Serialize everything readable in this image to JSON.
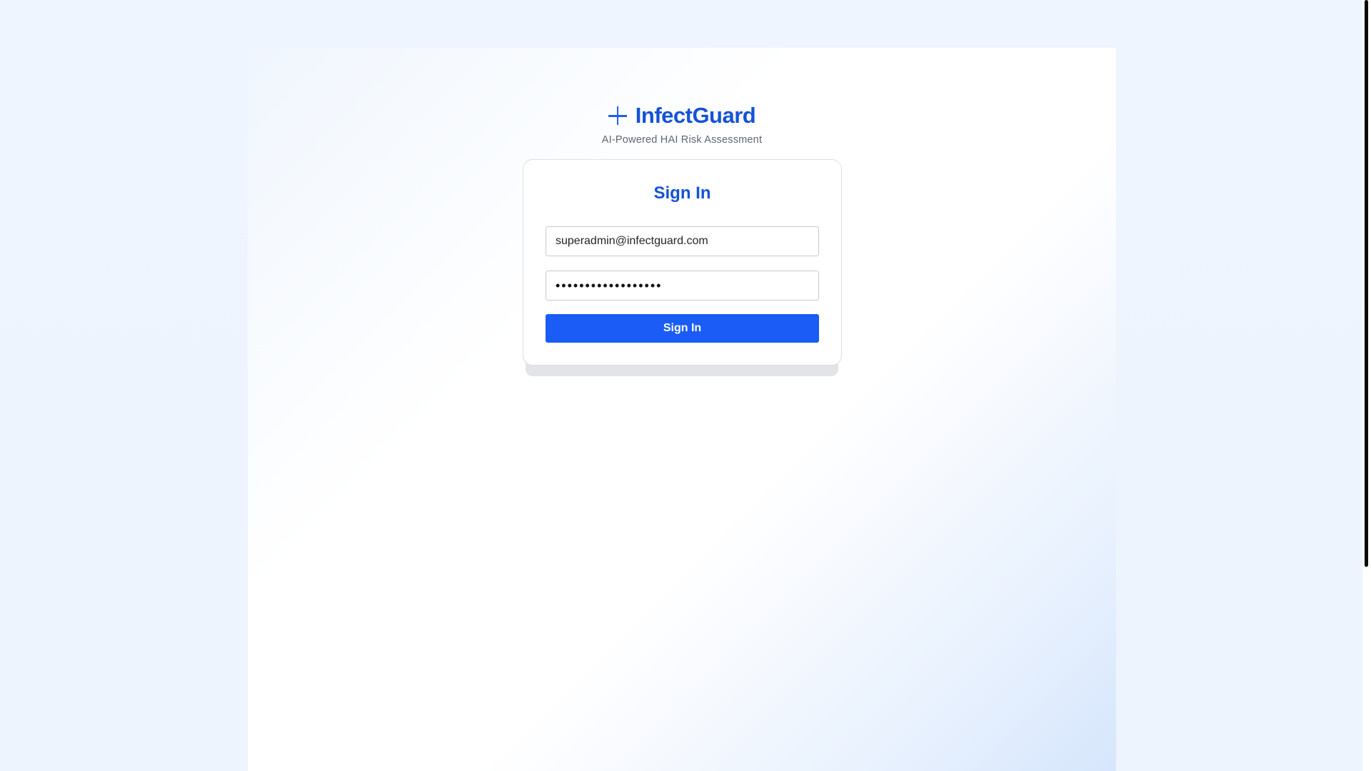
{
  "brand": {
    "name": "InfectGuard",
    "tagline": "AI-Powered HAI Risk Assessment",
    "icon": "plus-icon",
    "color": "#1552d6"
  },
  "login": {
    "title": "Sign In",
    "email_value": "superadmin@infectguard.com",
    "password_masked": "••••••••••••••••••",
    "submit_label": "Sign In",
    "button_color": "#1a5cf5"
  }
}
